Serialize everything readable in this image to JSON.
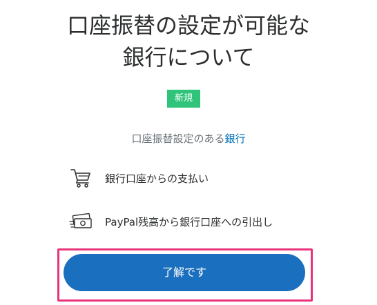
{
  "header": {
    "title_line1": "口座振替の設定が可能な",
    "title_line2": "銀行について"
  },
  "badge": {
    "label": "新規",
    "color": "#2fc47a"
  },
  "intro": {
    "prefix": "口座振替設定のある",
    "link_text": "銀行"
  },
  "features": [
    {
      "icon": "shopping-cart-icon",
      "label": "銀行口座からの支払い"
    },
    {
      "icon": "money-transfer-icon",
      "label": "PayPal残高から銀行口座への引出し"
    }
  ],
  "cta": {
    "label": "了解です",
    "color": "#1b6fbf",
    "highlight_color": "#e8337b"
  }
}
